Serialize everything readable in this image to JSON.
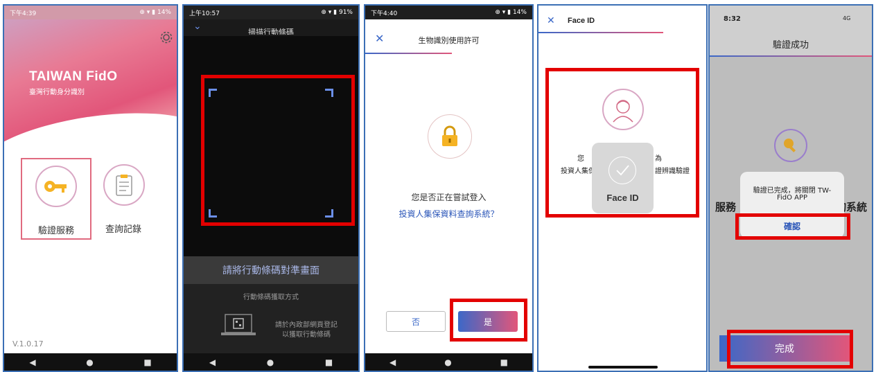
{
  "p1": {
    "status_time": "下午4:39",
    "status_right": "⊕ ▾ ▮ 14%",
    "brand_title": "TAIWAN FidO",
    "brand_subtitle": "臺灣行動身分識別",
    "btn_verify": "驗證服務",
    "btn_records": "查詢記錄",
    "version": "V.1.0.17"
  },
  "p2": {
    "status_time": "上午10:57",
    "status_right": "⊕ ▾ ▮ 91%",
    "header_title": "掃描行動條碼",
    "scan_prompt": "請將行動條碼對準畫面",
    "method_title": "行動條碼獲取方式",
    "method_desc_1": "請於內政部網頁登記",
    "method_desc_2": "以獲取行動條碼"
  },
  "p3": {
    "status_time": "下午4:40",
    "status_right": "⊕ ▾ ▮ 14%",
    "header_title": "生物識別使用許可",
    "question": "您是否正在嘗試登入",
    "system_link": "投資人集保資料查詢系統？",
    "no_label": "否",
    "yes_label": "是"
  },
  "p4": {
    "header_title": "Face ID",
    "bg_line1_left": "您",
    "bg_line1_right": "為",
    "bg_line2_left": "投資人集保",
    "bg_line2_right": "證辨識驗證",
    "overlay_label": "Face ID"
  },
  "p5": {
    "status_time": "8:32",
    "status_right": "4G",
    "header_title": "驗證成功",
    "bg_left": "服務",
    "bg_right": "詢系統",
    "alert_msg_line1": "驗證已完成，將關閉 TW-",
    "alert_msg_line2": "FidO APP",
    "confirm_label": "確認",
    "done_label": "完成"
  },
  "colors": {
    "brand_pink": "#e2567a",
    "brand_blue": "#3b68c8",
    "link_blue": "#2a55b8",
    "red_box": "#e30000",
    "panel_border": "#3b6fb5"
  }
}
